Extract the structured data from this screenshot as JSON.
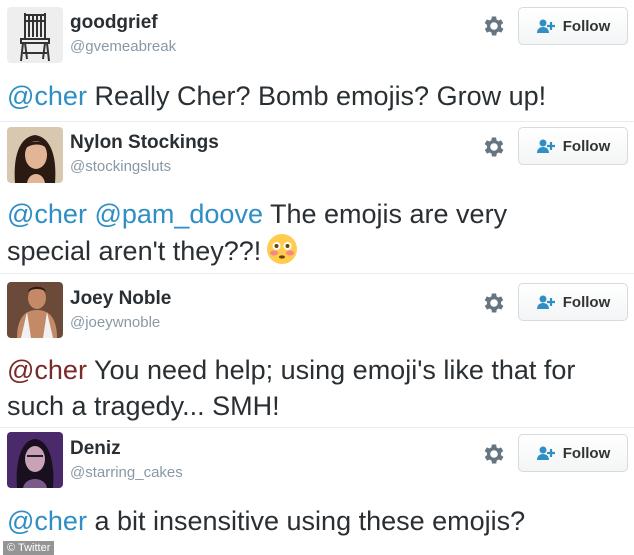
{
  "tweets": [
    {
      "name": "goodgrief",
      "handle": "@gvemeabreak",
      "follow_label": "Follow",
      "mention1": "@cher",
      "text": " Really Cher? Bomb emojis? Grow up!"
    },
    {
      "name": "Nylon Stockings",
      "handle": "@stockingsluts",
      "follow_label": "Follow",
      "mention1": "@cher",
      "mention2": "@pam_doove",
      "text_line1": " The emojis are very",
      "text_line2": "special aren't they??!"
    },
    {
      "name": "Joey Noble",
      "handle": "@joeywnoble",
      "follow_label": "Follow",
      "mention1": "@cher",
      "text_line1": " You need help; using emoji's like that for",
      "text_line2": "such a tragedy... SMH!"
    },
    {
      "name": "Deniz",
      "handle": "@starring_cakes",
      "follow_label": "Follow",
      "mention1": "@cher",
      "text": " a bit insensitive using these emojis?"
    }
  ],
  "watermark": "© Twitter",
  "icons": {
    "settings": "gear-icon",
    "follow": "add-user-icon",
    "emoji": "flushed-face-emoji"
  },
  "colors": {
    "mention": "#2f8fc4",
    "handle": "#8899a6",
    "text": "#292f33"
  }
}
